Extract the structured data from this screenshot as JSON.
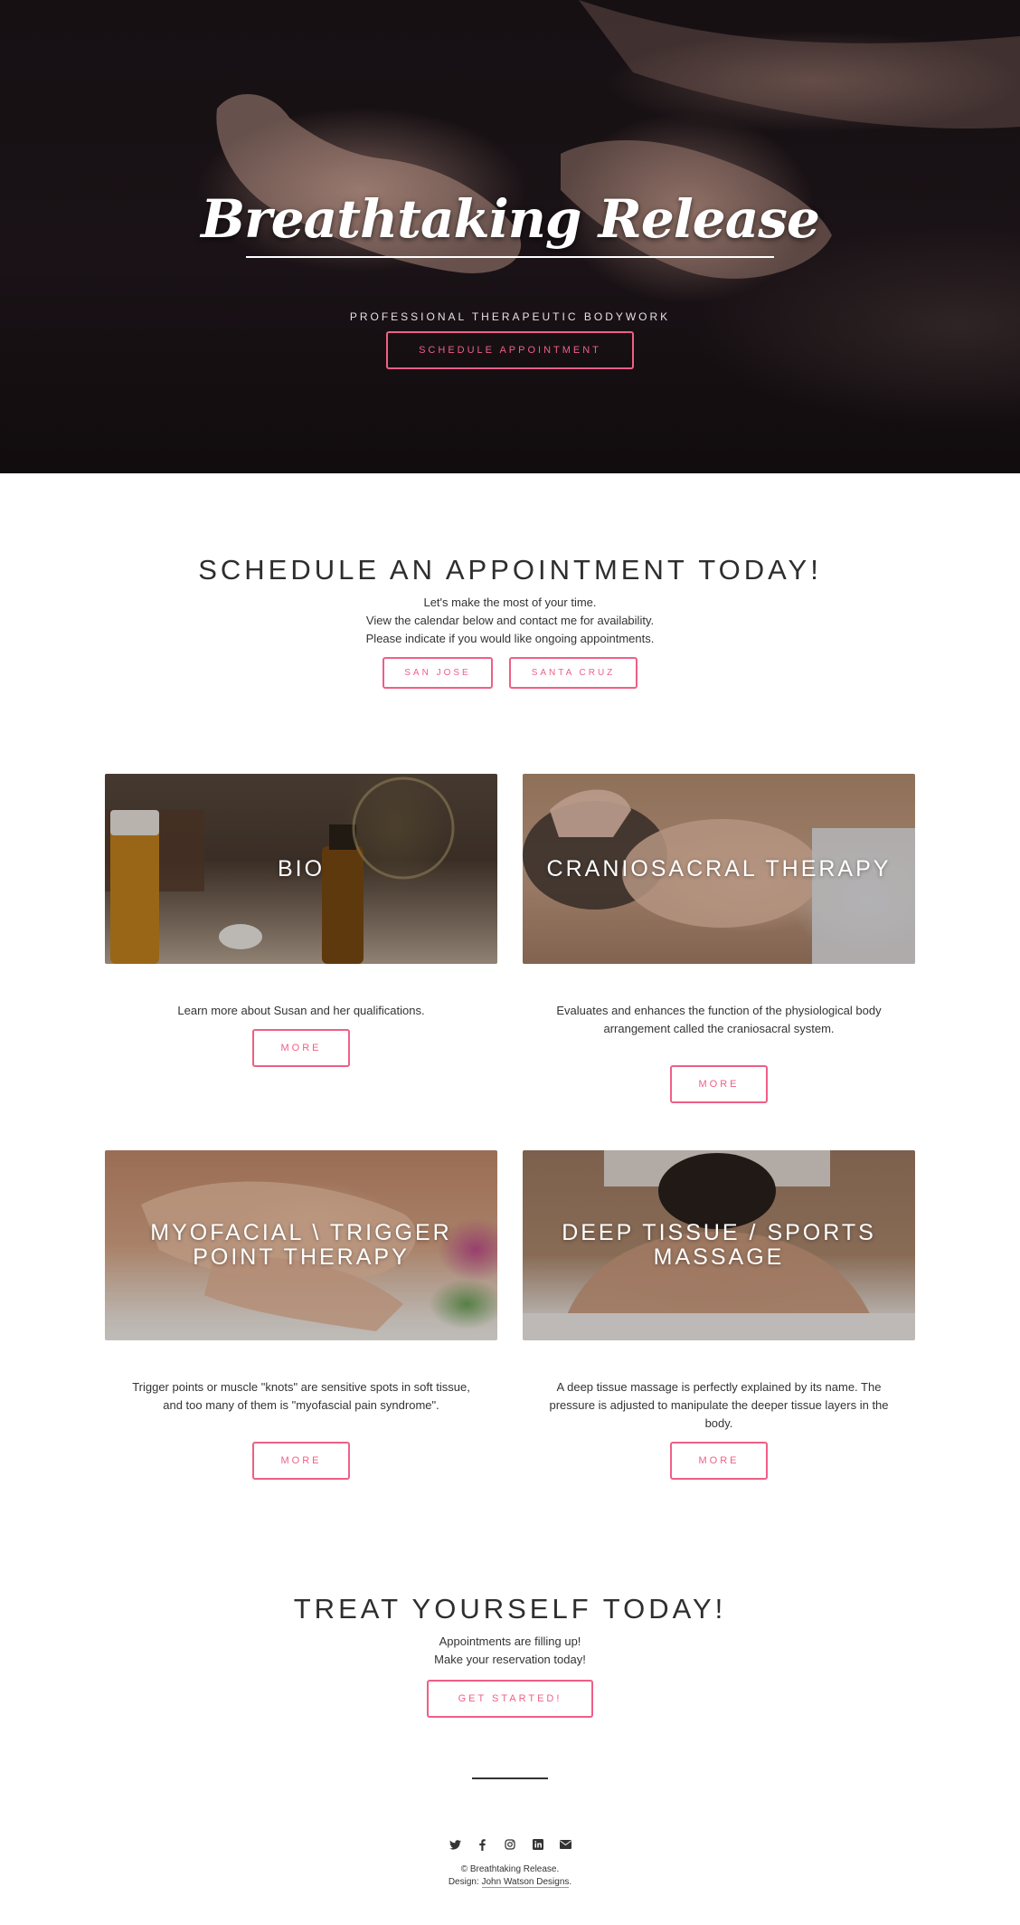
{
  "hero": {
    "title": "Breathtaking Release",
    "subtitle": "PROFESSIONAL THERAPEUTIC BODYWORK",
    "cta_label": "SCHEDULE APPOINTMENT"
  },
  "schedule": {
    "title": "SCHEDULE AN APPOINTMENT TODAY!",
    "lines": [
      "Let's make the most of your time.",
      "View the calendar below and contact me for availability.",
      "Please indicate if you would like ongoing appointments."
    ],
    "buttons": [
      "SAN JOSE",
      "SANTA CRUZ"
    ]
  },
  "cards": [
    {
      "title": "BIO",
      "description": "Learn more about Susan and her qualifications.",
      "button": "MORE"
    },
    {
      "title": "CRANIOSACRAL THERAPY",
      "description": "Evaluates and enhances the function of the physiological body arrangement called the craniosacral system.",
      "button": "MORE"
    },
    {
      "title": "MYOFACIAL \\ TRIGGER POINT THERAPY",
      "description": "Trigger points or muscle \"knots\" are sensitive spots in soft tissue, and too many of them is \"myofascial pain syndrome\".",
      "button": "MORE"
    },
    {
      "title": "DEEP TISSUE / SPORTS MASSAGE",
      "description": "A deep tissue massage is perfectly explained by its name. The pressure is adjusted to manipulate the deeper tissue layers in the body.",
      "button": "MORE"
    }
  ],
  "treat": {
    "title": "TREAT YOURSELF TODAY!",
    "lines": [
      "Appointments are filling up!",
      "Make your reservation today!"
    ],
    "cta_label": "GET STARTED!"
  },
  "footer": {
    "social_icons": [
      "twitter-icon",
      "facebook-icon",
      "instagram-icon",
      "linkedin-icon",
      "envelope-icon"
    ],
    "copyright": "© Breathtaking Release.",
    "design_prefix": "Design:",
    "design_link": "John Watson Designs",
    "design_suffix": "."
  },
  "colors": {
    "accent": "#ef5f86",
    "text": "#333333",
    "hero_bg": "#161013"
  }
}
